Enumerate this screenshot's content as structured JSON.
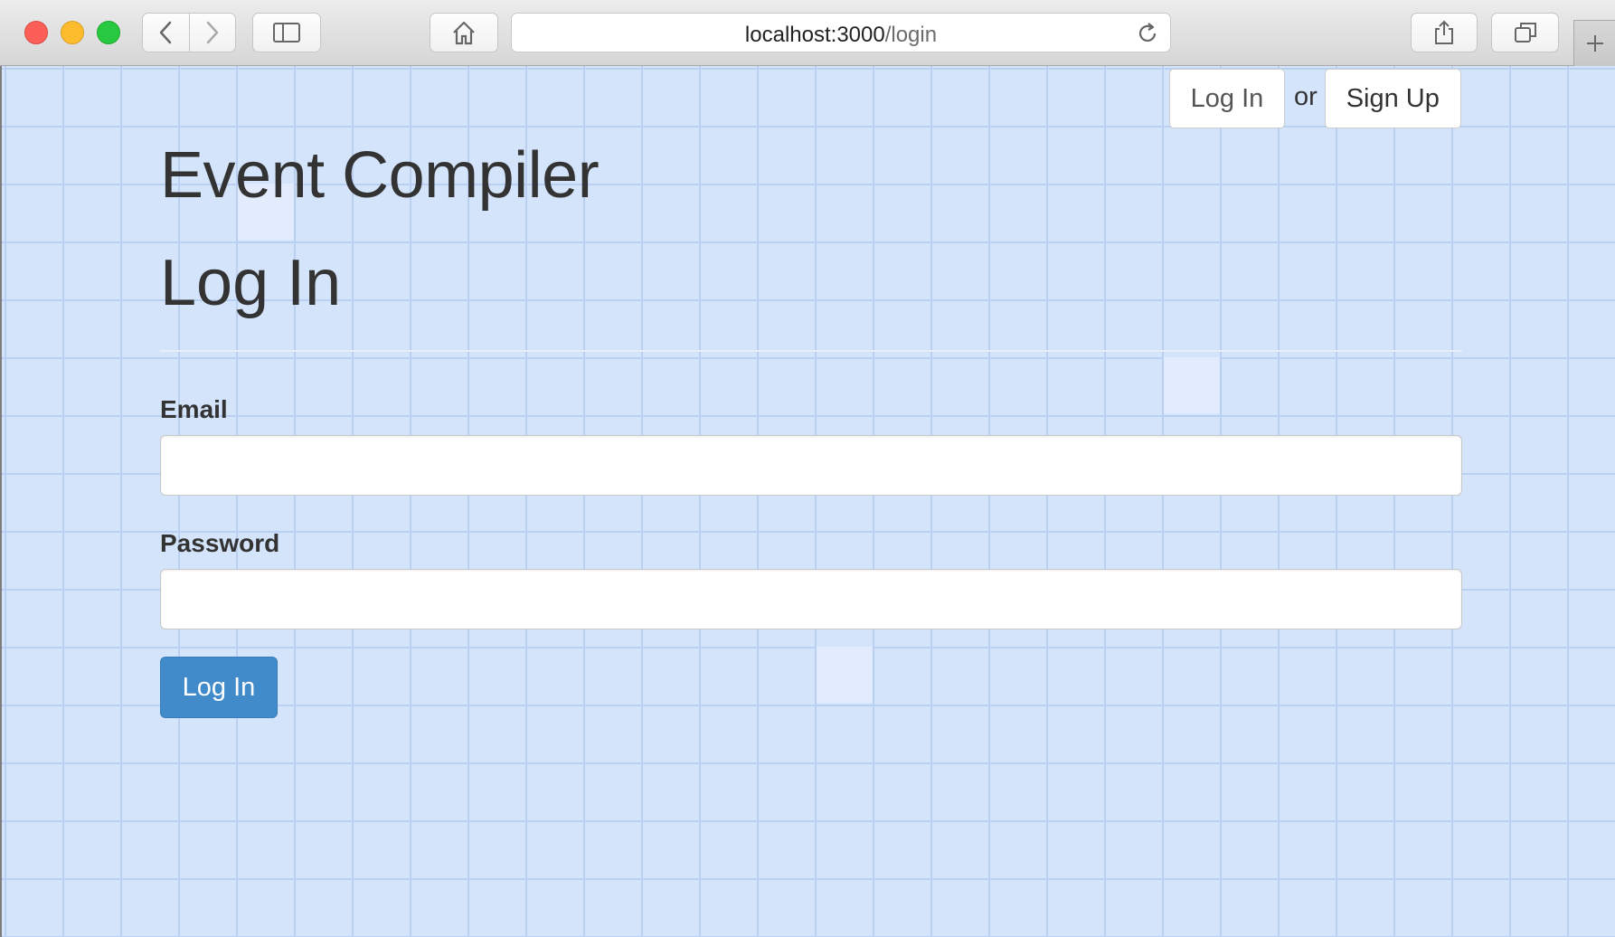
{
  "browser": {
    "url_host": "localhost:3000",
    "url_path": "/login",
    "icons": {
      "back": "chevron-left-icon",
      "forward": "chevron-right-icon",
      "sidebar": "sidebar-icon",
      "home": "home-icon",
      "reload": "reload-icon",
      "share": "share-icon",
      "tabs": "tabs-icon",
      "new_tab": "plus-icon"
    }
  },
  "header": {
    "login_label": "Log In",
    "or_text": "or",
    "signup_label": "Sign Up"
  },
  "main": {
    "app_title": "Event Compiler",
    "page_title": "Log In"
  },
  "form": {
    "email_label": "Email",
    "email_value": "",
    "password_label": "Password",
    "password_value": "",
    "submit_label": "Log In"
  },
  "colors": {
    "background": "#d4e4fb",
    "grid": "#b9d0f3",
    "primary": "#428bca",
    "text": "#333333"
  }
}
